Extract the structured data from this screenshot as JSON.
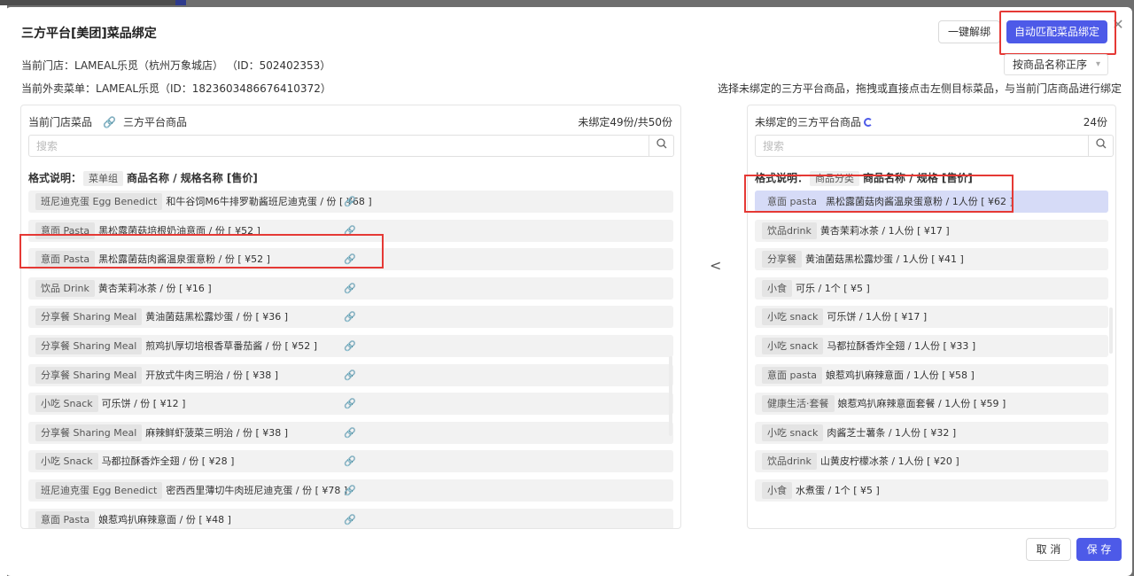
{
  "modal": {
    "title": "三方平台[美团]菜品绑定",
    "close_glyph": "✕",
    "unbind_label": "一键解绑",
    "auto_match_label": "自动匹配菜品绑定",
    "sort": {
      "selected": "按商品名称正序",
      "caret": "▾"
    },
    "store_line": "当前门店：LAMEAL乐觅（杭州万象城店） （ID：502402353）",
    "menu_line": "当前外卖菜单：LAMEAL乐觅（ID：1823603486676410372）",
    "hint": "选择未绑定的三方平台商品，拖拽或直接点击左侧目标菜品，与当前门店商品进行绑定",
    "move_arrow": "<",
    "cancel_label": "取 消",
    "save_label": "保 存"
  },
  "left_panel": {
    "head_store": "当前门店菜品",
    "head_link_icon": "🔗",
    "head_platform": "三方平台商品",
    "count": "未绑定49份/共50份",
    "search_placeholder": "搜索",
    "format_label": "格式说明：",
    "format_tag": "菜单组",
    "format_rest": "商品名称 / 规格名称 [售价]",
    "rows": [
      {
        "cat": "班尼迪克蛋 Egg Benedict",
        "text": "和牛谷饲M6牛排罗勒酱班尼迪克蛋 / 份 [ ¥68 ]"
      },
      {
        "cat": "意面 Pasta",
        "text": "黑松露菌菇培根奶油意面 / 份 [ ¥52 ]"
      },
      {
        "cat": "意面 Pasta",
        "text": "黑松露菌菇肉酱温泉蛋意粉 / 份 [ ¥52 ]"
      },
      {
        "cat": "饮品 Drink",
        "text": "黄杏茉莉冰茶 / 份 [ ¥16 ]"
      },
      {
        "cat": "分享餐 Sharing Meal",
        "text": "黄油菌菇黑松露炒蛋 / 份 [ ¥36 ]"
      },
      {
        "cat": "分享餐 Sharing Meal",
        "text": "煎鸡扒厚切培根香草番茄酱 / 份 [ ¥52 ]"
      },
      {
        "cat": "分享餐 Sharing Meal",
        "text": "开放式牛肉三明治 / 份 [ ¥38 ]"
      },
      {
        "cat": "小吃 Snack",
        "text": "可乐饼 / 份 [ ¥12 ]"
      },
      {
        "cat": "分享餐 Sharing Meal",
        "text": "麻辣鲜虾菠菜三明治 / 份 [ ¥38 ]"
      },
      {
        "cat": "小吃 Snack",
        "text": "马都拉酥香炸全翅 / 份 [ ¥28 ]"
      },
      {
        "cat": "班尼迪克蛋 Egg Benedict",
        "text": "密西西里薄切牛肉班尼迪克蛋 / 份 [ ¥78 ]"
      },
      {
        "cat": "意面 Pasta",
        "text": "娘惹鸡扒麻辣意面 / 份 [ ¥48 ]"
      }
    ]
  },
  "right_panel": {
    "head": "未绑定的三方平台商品",
    "count": "24份",
    "search_placeholder": "搜索",
    "format_label": "格式说明：",
    "format_tag": "商品分类",
    "format_rest": "商品名称 / 规格 [售价]",
    "rows": [
      {
        "cat": "意面 pasta",
        "text": "黑松露菌菇肉酱温泉蛋意粉 / 1人份 [ ¥62 ]"
      },
      {
        "cat": "饮品drink",
        "text": "黄杏茉莉冰茶 / 1人份 [ ¥17 ]"
      },
      {
        "cat": "分享餐",
        "text": "黄油菌菇黑松露炒蛋 / 1人份 [ ¥41 ]"
      },
      {
        "cat": "小食",
        "text": "可乐 / 1个 [ ¥5 ]"
      },
      {
        "cat": "小吃 snack",
        "text": "可乐饼 / 1人份 [ ¥17 ]"
      },
      {
        "cat": "小吃 snack",
        "text": "马都拉酥香炸全翅 / 1人份 [ ¥33 ]"
      },
      {
        "cat": "意面 pasta",
        "text": "娘惹鸡扒麻辣意面 / 1人份 [ ¥58 ]"
      },
      {
        "cat": "健康生活·套餐",
        "text": "娘惹鸡扒麻辣意面套餐 / 1人份 [ ¥59 ]"
      },
      {
        "cat": "小吃 snack",
        "text": "肉酱芝士薯条 / 1人份 [ ¥32 ]"
      },
      {
        "cat": "饮品drink",
        "text": "山黄皮柠檬冰茶 / 1人份 [ ¥20 ]"
      },
      {
        "cat": "小食",
        "text": "水煮蛋 / 1个 [ ¥5 ]"
      }
    ]
  },
  "colors": {
    "primary": "#4d5ae8",
    "highlight": "#e53935",
    "selected_row": "#d6dbf7",
    "row_bg": "#f2f2f2"
  },
  "icons": {
    "link": "link-icon",
    "search": "search-icon",
    "close": "close-icon",
    "arrow": "chevron-left-icon",
    "spinner": "loading-spinner-icon"
  }
}
